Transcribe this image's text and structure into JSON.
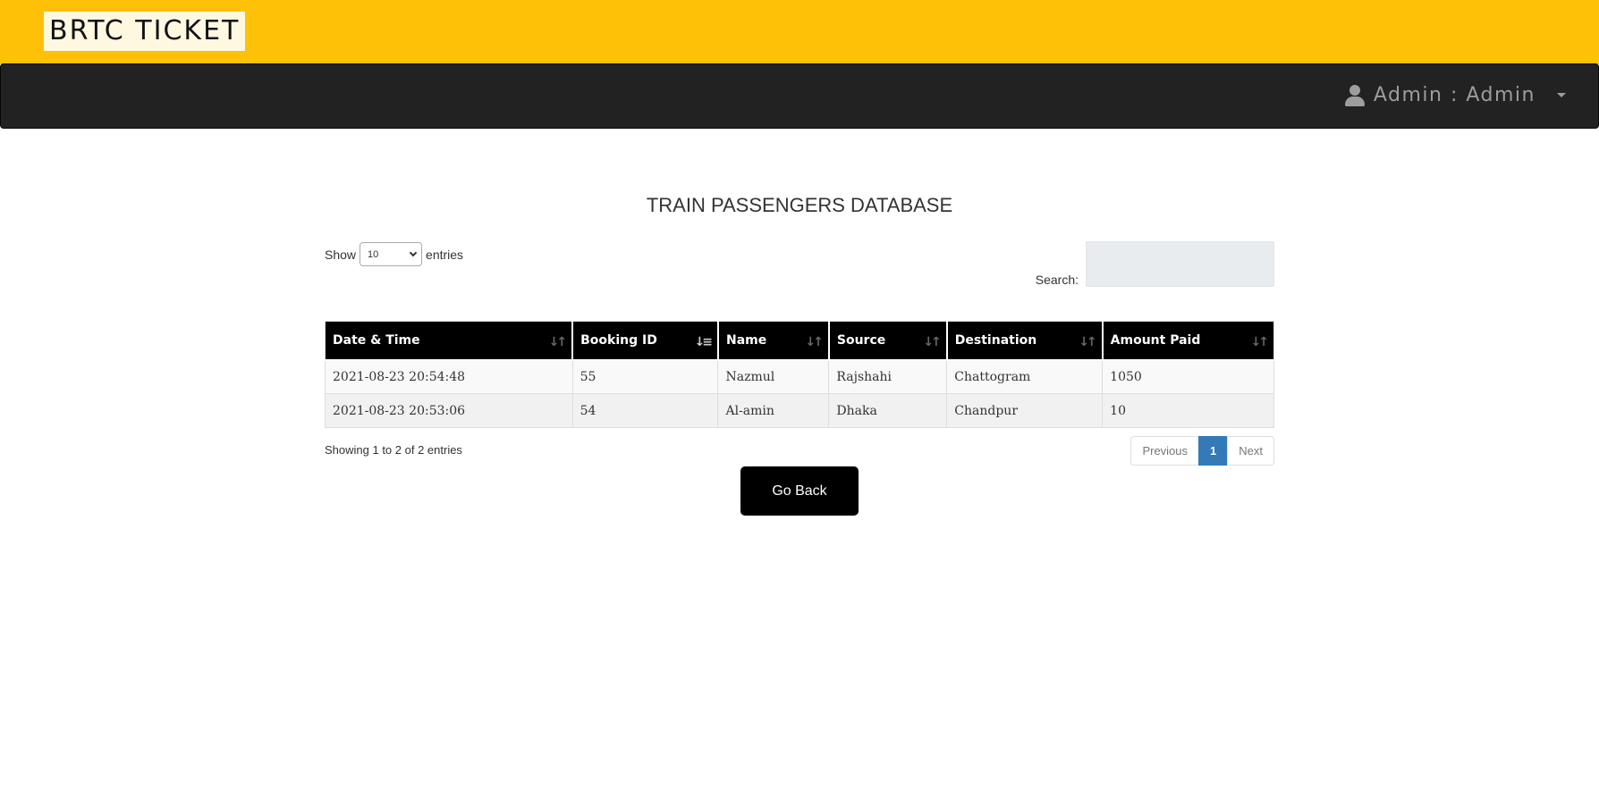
{
  "brand": {
    "title": "BRTC TICKET"
  },
  "navbar": {
    "user_label": "Admin : Admin"
  },
  "page": {
    "title": "TRAIN PASSENGERS DATABASE"
  },
  "length_control": {
    "show_label": "Show",
    "selected": "10",
    "entries_label": "entries"
  },
  "search": {
    "label": "Search:",
    "value": ""
  },
  "table": {
    "columns": [
      "Date & Time",
      "Booking ID",
      "Name",
      "Source",
      "Destination",
      "Amount Paid"
    ],
    "rows": [
      [
        "2021-08-23 20:54:48",
        "55",
        "Nazmul",
        "Rajshahi",
        "Chattogram",
        "1050"
      ],
      [
        "2021-08-23 20:53:06",
        "54",
        "Al-amin",
        "Dhaka",
        "Chandpur",
        "10"
      ]
    ]
  },
  "info": {
    "text": "Showing 1 to 2 of 2 entries"
  },
  "pagination": {
    "previous": "Previous",
    "current": "1",
    "next": "Next"
  },
  "actions": {
    "go_back": "Go Back"
  },
  "colors": {
    "top_bar": "#ffc107",
    "navbar": "#222222",
    "active_page": "#337ab7"
  },
  "icons": {
    "user": "user-icon",
    "caret": "caret-down-icon",
    "sort": "sort-icon"
  }
}
